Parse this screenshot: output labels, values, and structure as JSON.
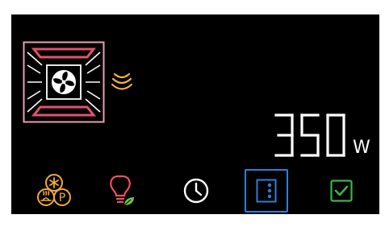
{
  "display": {
    "power_digits": [
      "3",
      "5",
      "0"
    ],
    "power_unit": "W"
  },
  "icons": {
    "oven": "oven-fan-top-bottom-heat-icon",
    "waves": "microwave-waves-icon",
    "modes": "cooking-modes-icon",
    "light": "eco-light-bulb-icon",
    "timer": "clock-icon",
    "tray": "tray-position-icon",
    "confirm": "checkbox-confirm-icon"
  },
  "colors": {
    "background": "#000000",
    "heater_red": "#e0546a",
    "heater_pink": "#e8a0b4",
    "fan_white": "#ffffff",
    "wave_orange": "#f2b233",
    "modes_orange": "#f2a93c",
    "light_red": "#f0505f",
    "leaf_green": "#6fbf4a",
    "tray_blue": "#2f7fd8",
    "confirm_green": "#39b54a"
  }
}
